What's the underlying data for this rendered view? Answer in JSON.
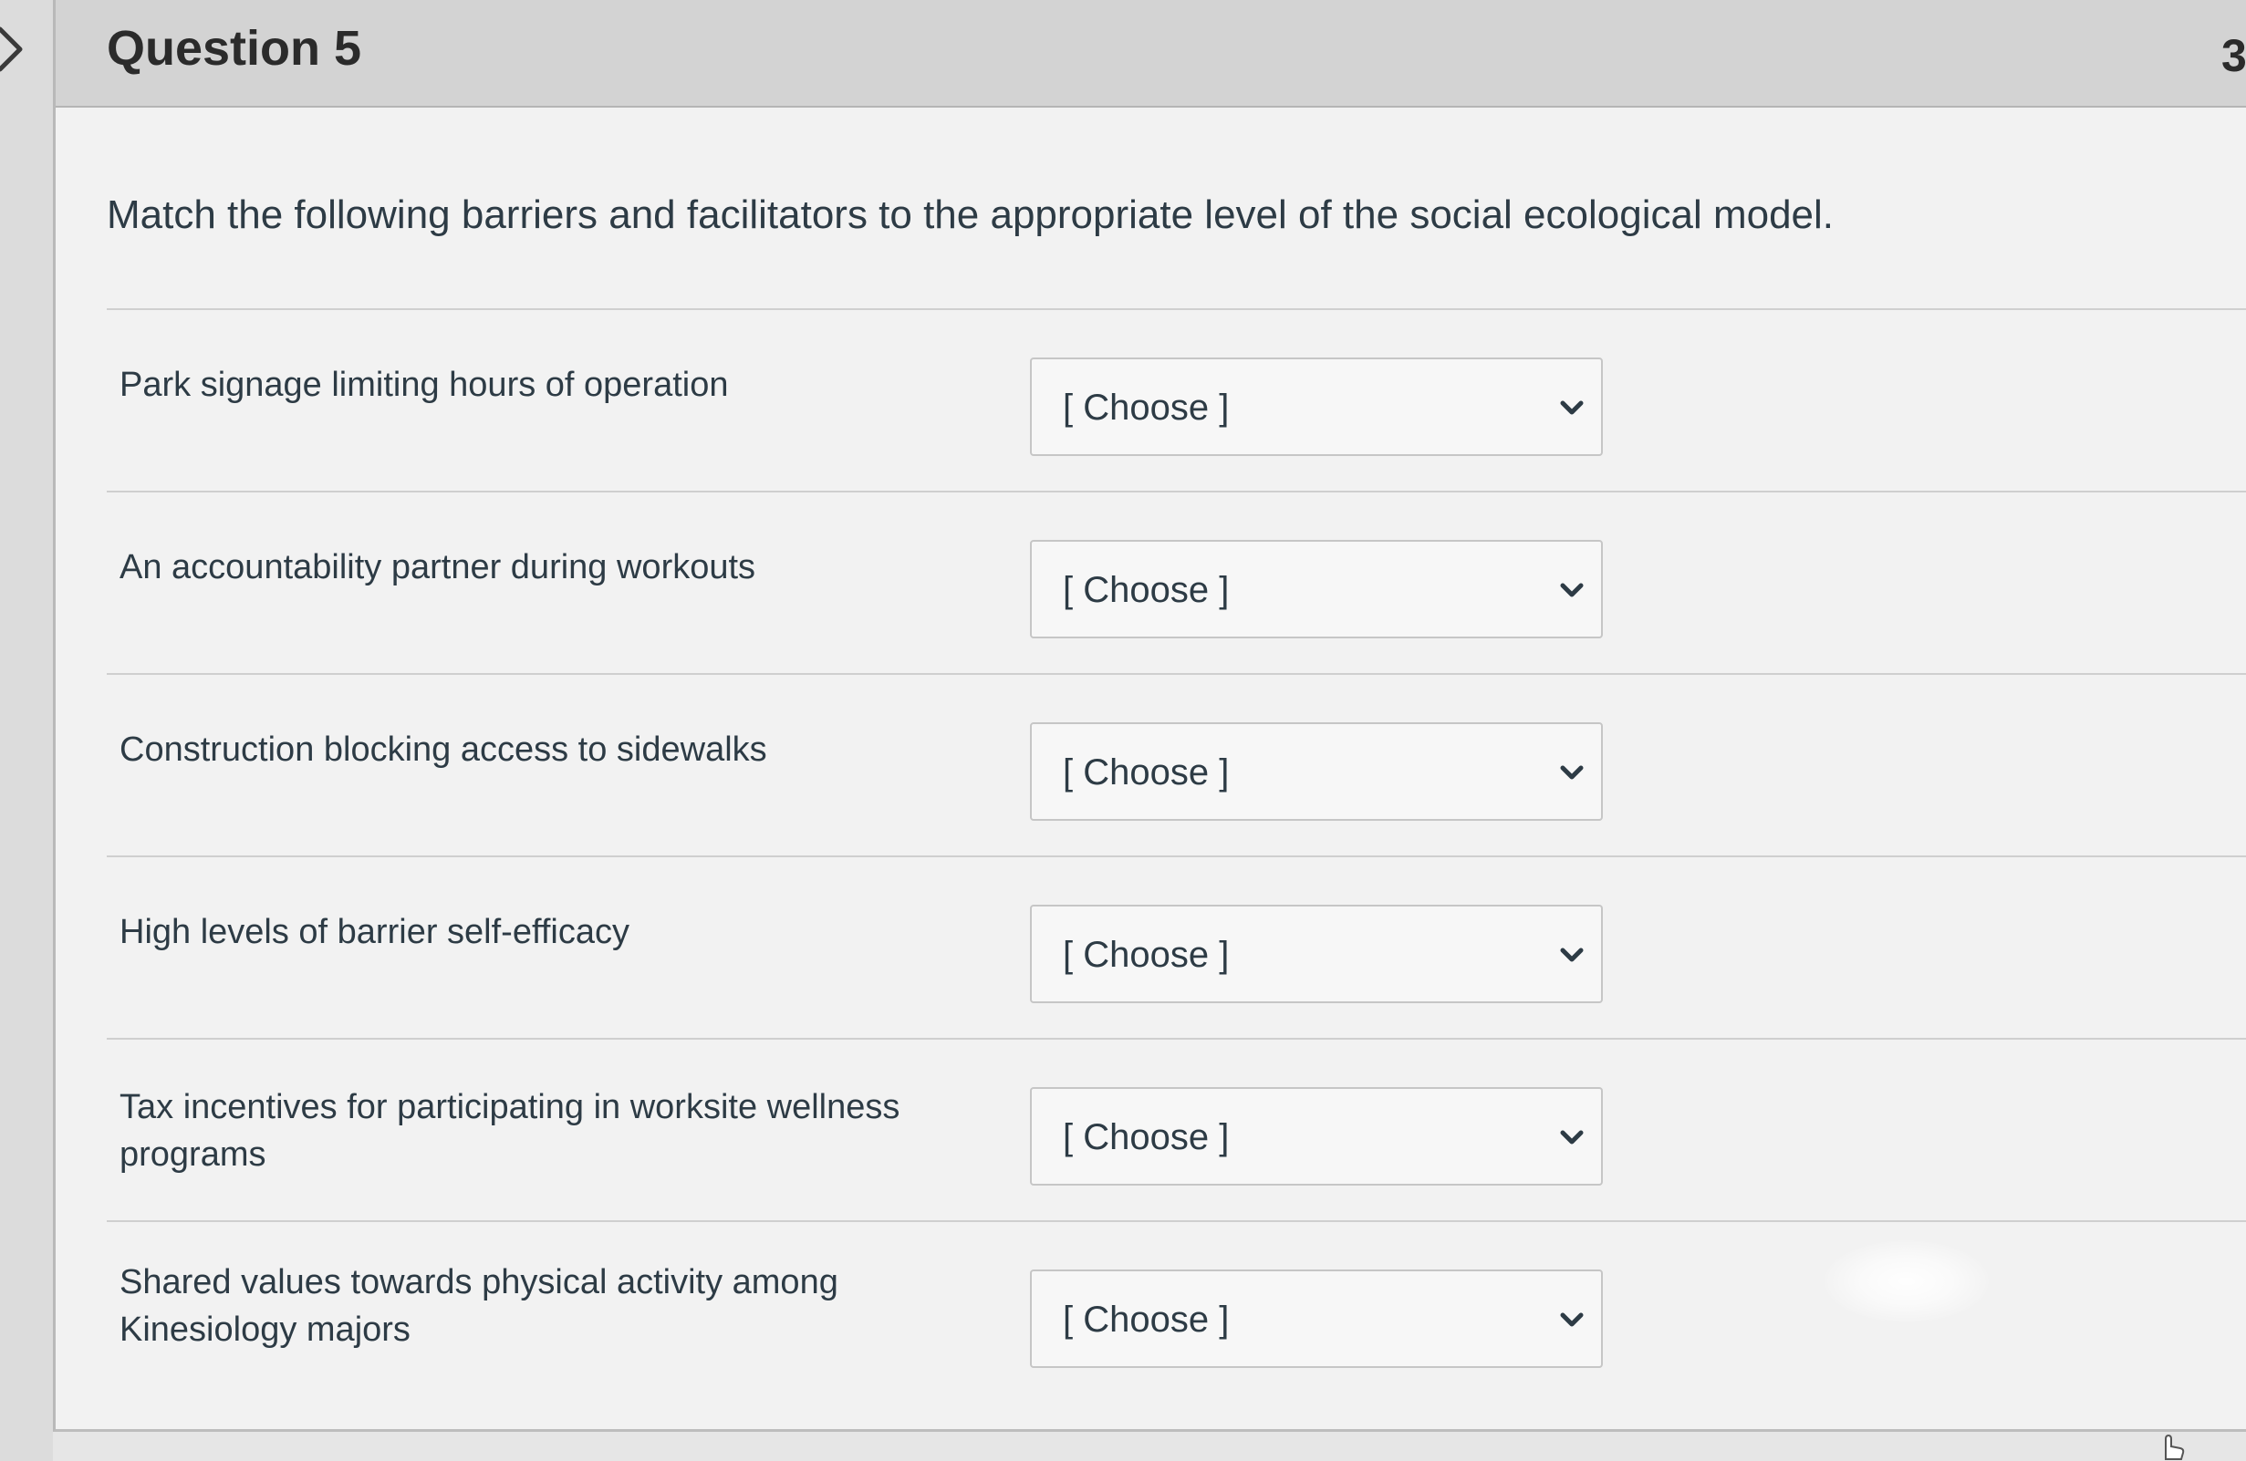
{
  "question": {
    "title": "Question 5",
    "points": "3",
    "prompt": "Match the following barriers and facilitators to the appropriate level of the social ecological model."
  },
  "answers": [
    {
      "label": "Park signage limiting hours of operation",
      "selected": "[ Choose ]"
    },
    {
      "label": "An accountability partner during workouts",
      "selected": "[ Choose ]"
    },
    {
      "label": "Construction blocking access to sidewalks",
      "selected": "[ Choose ]"
    },
    {
      "label": "High levels of barrier self-efficacy",
      "selected": "[ Choose ]"
    },
    {
      "label": "Tax incentives for participating in worksite wellness programs",
      "selected": "[ Choose ]"
    },
    {
      "label": "Shared values towards physical activity among Kinesiology majors",
      "selected": "[ Choose ]"
    }
  ],
  "icons": {
    "expand": "chevron-right-icon",
    "dropdown": "chevron-down-icon",
    "cursor": "hand-pointer-icon"
  },
  "colors": {
    "header_bg": "#d3d3d3",
    "card_bg": "#f2f2f2",
    "text": "#2d3b45"
  }
}
